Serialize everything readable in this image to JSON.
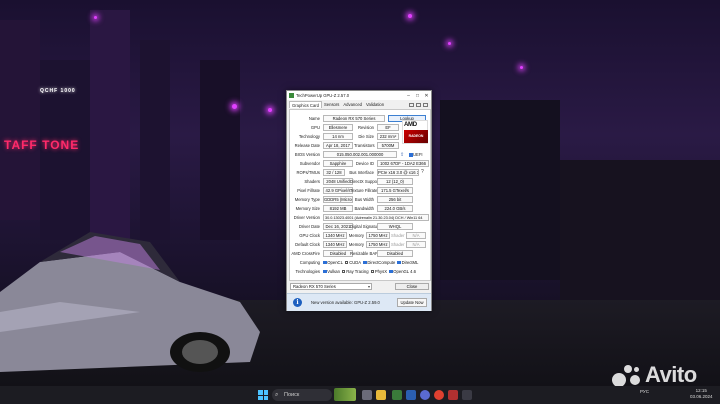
{
  "window": {
    "title": "TechPowerUp GPU-Z 2.57.0",
    "tabs": [
      "Graphics Card",
      "Sensors",
      "Advanced",
      "Validation"
    ]
  },
  "fields": {
    "name_label": "Name",
    "name": "Radeon RX 570 Series",
    "lookup": "Lookup",
    "gpu_label": "GPU",
    "gpu": "Ellesmere",
    "revision_label": "Revision",
    "revision": "EF",
    "technology_label": "Technology",
    "technology": "14 nm",
    "die_size_label": "Die Size",
    "die_size": "232 mm²",
    "release_date_label": "Release Date",
    "release_date": "Apr 18, 2017",
    "transistors_label": "Transistors",
    "transistors": "5700M",
    "bios_label": "BIOS Version",
    "bios": "015.050.002.001.000000",
    "uefi": "UEFI",
    "subvendor_label": "Subvendor",
    "subvendor": "Sapphire",
    "device_id_label": "Device ID",
    "device_id": "1002 67DF - 1DA2 E366",
    "rops_label": "ROPs/TMUs",
    "rops": "32 / 128",
    "bus_interface_label": "Bus Interface",
    "bus_interface": "PCIe x16 3.0 @ x16 3.0",
    "shaders_label": "Shaders",
    "shaders": "2048 Unified",
    "directx_label": "DirectX Support",
    "directx": "12 (12_0)",
    "pixel_fillrate_label": "Pixel Fillrate",
    "pixel_fillrate": "42.9 GPixel/s",
    "texture_fillrate_label": "Texture Fillrate",
    "texture_fillrate": "171.5 GTexel/s",
    "memory_type_label": "Memory Type",
    "memory_type": "GDDR5 (Micron)",
    "bus_width_label": "Bus Width",
    "bus_width": "256 bit",
    "memory_size_label": "Memory Size",
    "memory_size": "8192 MB",
    "bandwidth_label": "Bandwidth",
    "bandwidth": "224.0 GB/s",
    "driver_version_label": "Driver Version",
    "driver_version": "30.0.13023.4001 (Adrenalin 21.30.23.04) DCH / Win11 64",
    "driver_date_label": "Driver Date",
    "driver_date": "Dec 16, 2021",
    "digital_signature_label": "Digital Signature",
    "digital_signature": "WHQL",
    "gpu_clock_label": "GPU Clock",
    "gpu_clock": "1340 MHz",
    "memory_label": "Memory",
    "gpu_memory": "1750 MHz",
    "shader_label": "Shader",
    "shader_na": "N/A",
    "default_clock_label": "Default Clock",
    "default_clock": "1340 MHz",
    "default_memory": "1750 MHz",
    "crossfire_label": "AMD CrossFire",
    "crossfire": "Disabled",
    "resizable_bar_label": "Resizable BAR",
    "resizable_bar": "Disabled",
    "computing_label": "Computing",
    "technologies_label": "Technologies"
  },
  "computing": [
    {
      "label": "OpenCL",
      "checked": true
    },
    {
      "label": "CUDA",
      "checked": false
    },
    {
      "label": "DirectCompute",
      "checked": true
    },
    {
      "label": "DirectML",
      "checked": true
    }
  ],
  "technologies": [
    {
      "label": "Vulkan",
      "checked": true
    },
    {
      "label": "Ray Tracing",
      "checked": false
    },
    {
      "label": "PhysX",
      "checked": false
    },
    {
      "label": "OpenGL 4.6",
      "checked": true
    }
  ],
  "footer": {
    "selected_gpu": "Radeon RX 570 Series",
    "close": "Close",
    "update_message": "New version available: GPU-Z 2.59.0",
    "update_button": "Update Now"
  },
  "amd_logo": {
    "brand": "AMD",
    "product": "RADEON"
  },
  "taskbar": {
    "search_label": "Поиск",
    "language": "РУС",
    "time": "12:15",
    "date": "03.06.2024"
  },
  "watermark": "Avito",
  "wallpaper_signs": {
    "left_sign": "TAFF TONE",
    "small_sign": "QCHF 1000"
  }
}
